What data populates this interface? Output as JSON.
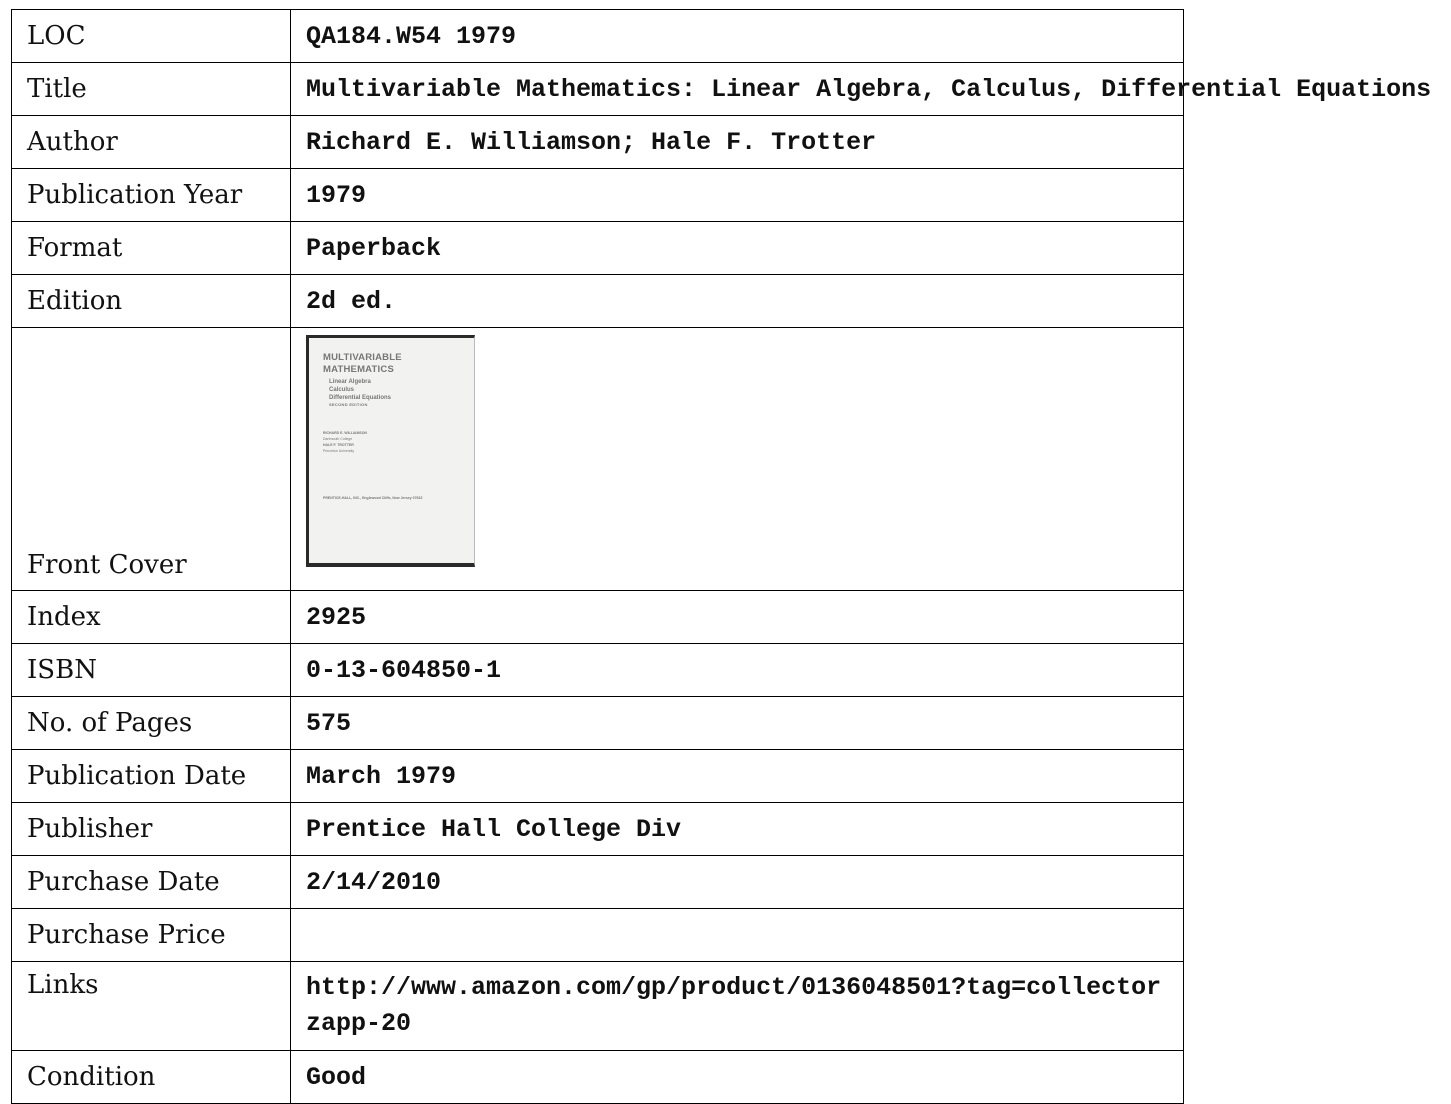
{
  "record": {
    "loc": {
      "label": "LOC",
      "value": "QA184.W54 1979"
    },
    "title": {
      "label": "Title",
      "value": "Multivariable Mathematics: Linear Algebra, Calculus, Differential Equations"
    },
    "author": {
      "label": "Author",
      "value": "Richard E. Williamson; Hale F. Trotter"
    },
    "publication_year": {
      "label": "Publication Year",
      "value": "1979"
    },
    "format": {
      "label": "Format",
      "value": "Paperback"
    },
    "edition": {
      "label": "Edition",
      "value": "2d ed."
    },
    "front_cover": {
      "label": "Front Cover",
      "cover_text": {
        "title_line1": "MULTIVARIABLE",
        "title_line2": "MATHEMATICS",
        "sub_line1": "Linear Algebra",
        "sub_line2": "Calculus",
        "sub_line3": "Differential Equations",
        "edition_line": "SECOND EDITION",
        "author1": "RICHARD E. WILLIAMSON",
        "author1_affil": "Dartmouth College",
        "author2": "HALE F. TROTTER",
        "author2_affil": "Princeton University",
        "publisher_line": "PRENTICE-HALL, INC., Englewood Cliffs, New Jersey 07632"
      }
    },
    "index": {
      "label": "Index",
      "value": "2925"
    },
    "isbn": {
      "label": "ISBN",
      "value": "0-13-604850-1"
    },
    "pages": {
      "label": "No. of Pages",
      "value": "575"
    },
    "publication_date": {
      "label": "Publication Date",
      "value": "March 1979"
    },
    "publisher": {
      "label": "Publisher",
      "value": "Prentice Hall College Div"
    },
    "purchase_date": {
      "label": "Purchase Date",
      "value": "2/14/2010"
    },
    "purchase_price": {
      "label": "Purchase Price",
      "value": ""
    },
    "links": {
      "label": "Links",
      "value": "http://www.amazon.com/gp/product/0136048501?tag=collectorzapp-20"
    },
    "condition": {
      "label": "Condition",
      "value": "Good"
    }
  }
}
